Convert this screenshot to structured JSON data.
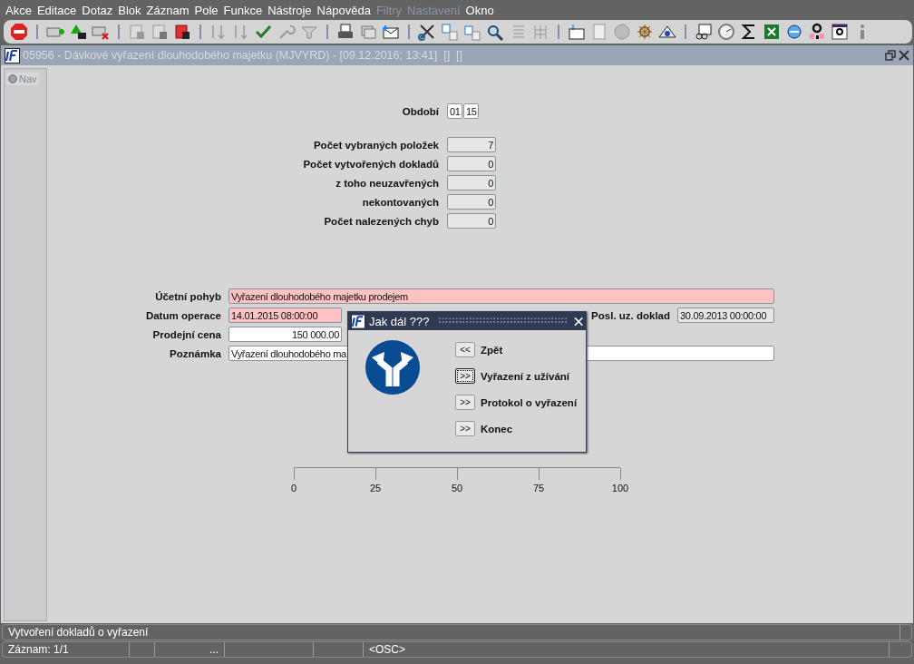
{
  "menu": [
    {
      "label": "Akce",
      "disabled": false
    },
    {
      "label": "Editace",
      "disabled": false
    },
    {
      "label": "Dotaz",
      "disabled": false
    },
    {
      "label": "Blok",
      "disabled": false
    },
    {
      "label": "Záznam",
      "disabled": false
    },
    {
      "label": "Pole",
      "disabled": false
    },
    {
      "label": "Funkce",
      "disabled": false
    },
    {
      "label": "Nástroje",
      "disabled": false
    },
    {
      "label": "Nápověda",
      "disabled": false
    },
    {
      "label": "Filtry",
      "disabled": true
    },
    {
      "label": "Nastavení",
      "disabled": true
    },
    {
      "label": "Okno",
      "disabled": false
    }
  ],
  "window": {
    "title": "05956 - Dávkové vyřazení dlouhodobého majetku (MJVYRD) - [09.12.2016; 13:41]  []  []"
  },
  "nav": {
    "label": "Nav"
  },
  "period": {
    "label": "Období",
    "month": "01",
    "year": "15"
  },
  "stats": [
    {
      "label": "Počet vybraných položek",
      "value": "7"
    },
    {
      "label": "Počet vytvořených dokladů",
      "value": "0"
    },
    {
      "label": "z toho  neuzavřených",
      "value": "0"
    },
    {
      "label": "nekontovaných",
      "value": "0"
    },
    {
      "label": "Počet nalezených chyb",
      "value": "0"
    }
  ],
  "fields": [
    {
      "label": "Účetní pohyb",
      "value": "Vyřazení dlouhodobého majetku prodejem",
      "required": true,
      "kind": "wide"
    },
    {
      "label": "Datum operace",
      "value": "14.01.2015 08:00:00",
      "required": true,
      "kind": "short",
      "secondary": {
        "label": "Posl. uz. doklad",
        "value": "30.09.2013 00:00:00"
      }
    },
    {
      "label": "Prodejní cena",
      "value": "150 000.00",
      "required": false,
      "kind": "number"
    },
    {
      "label": "Poznámka",
      "value": "Vyřazení dlouhodobého ma",
      "required": false,
      "kind": "wide"
    }
  ],
  "progress": {
    "ticks": [
      "0",
      "25",
      "50",
      "75",
      "100"
    ]
  },
  "dialog": {
    "title": "Jak dál ???",
    "buttons": [
      {
        "symbol": "<<",
        "label": "Zpět",
        "focused": false
      },
      {
        "symbol": ">>",
        "label": "Vyřazení z užívání",
        "focused": true
      },
      {
        "symbol": ">>",
        "label": "Protokol o vyřazení",
        "focused": false
      },
      {
        "symbol": ">>",
        "label": "Konec",
        "focused": false
      }
    ]
  },
  "status_bar": {
    "message": "Vytvoření dokladů o vyřazení",
    "record": "Záznam: 1/1",
    "ellipsis": "...",
    "mode": "<OSC>"
  }
}
